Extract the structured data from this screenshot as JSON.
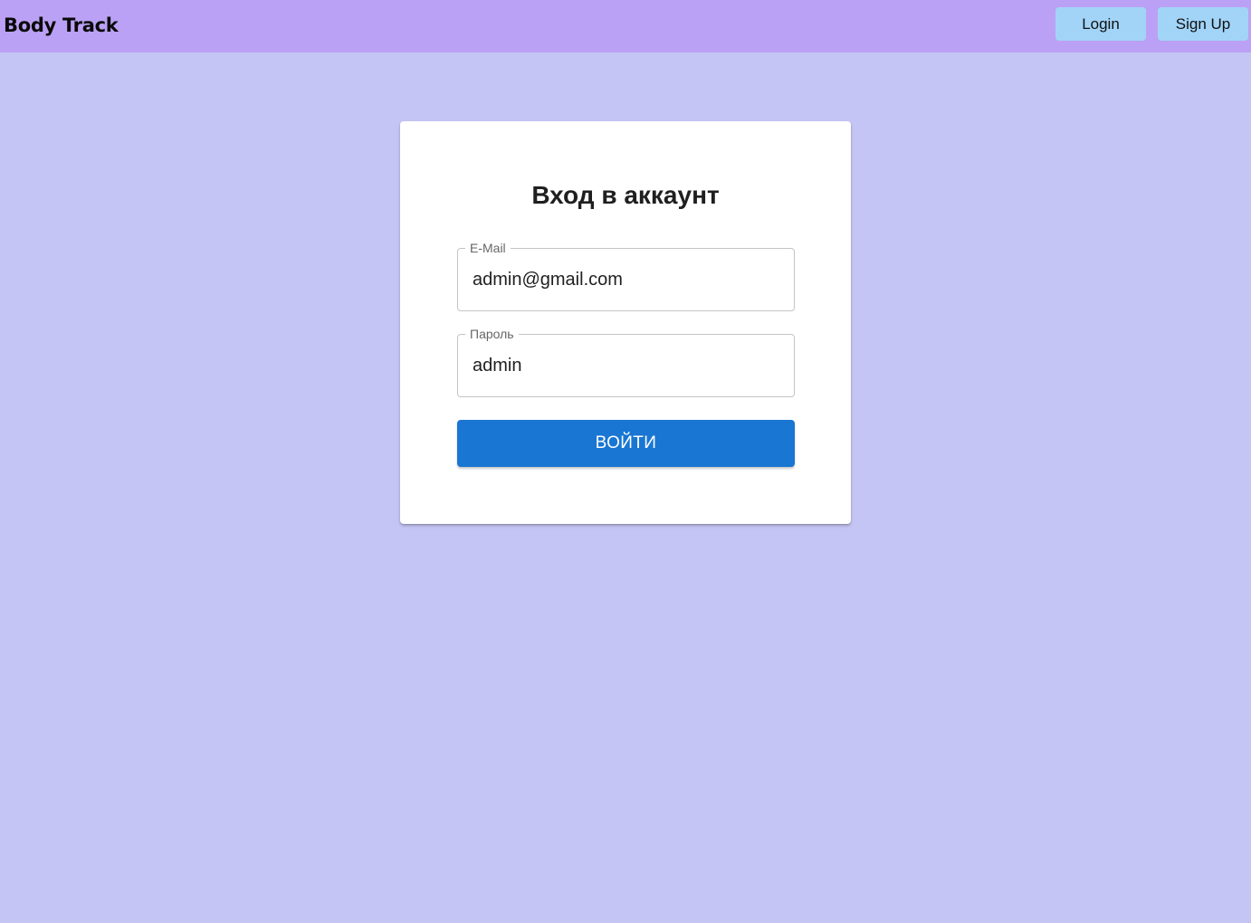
{
  "app": {
    "brand": "Body Track"
  },
  "nav": {
    "login_label": "Login",
    "signup_label": "Sign Up"
  },
  "login_form": {
    "title": "Вход в аккаунт",
    "email": {
      "label": "E-Mail",
      "value": "admin@gmail.com"
    },
    "password": {
      "label": "Пароль",
      "value": "admin"
    },
    "submit_label": "ВОЙТИ"
  },
  "colors": {
    "background": "#c5c5f5",
    "topbar": "#bba1f5",
    "nav_button": "#a2d4f7",
    "primary_button": "#1976d3",
    "card": "#ffffff"
  }
}
